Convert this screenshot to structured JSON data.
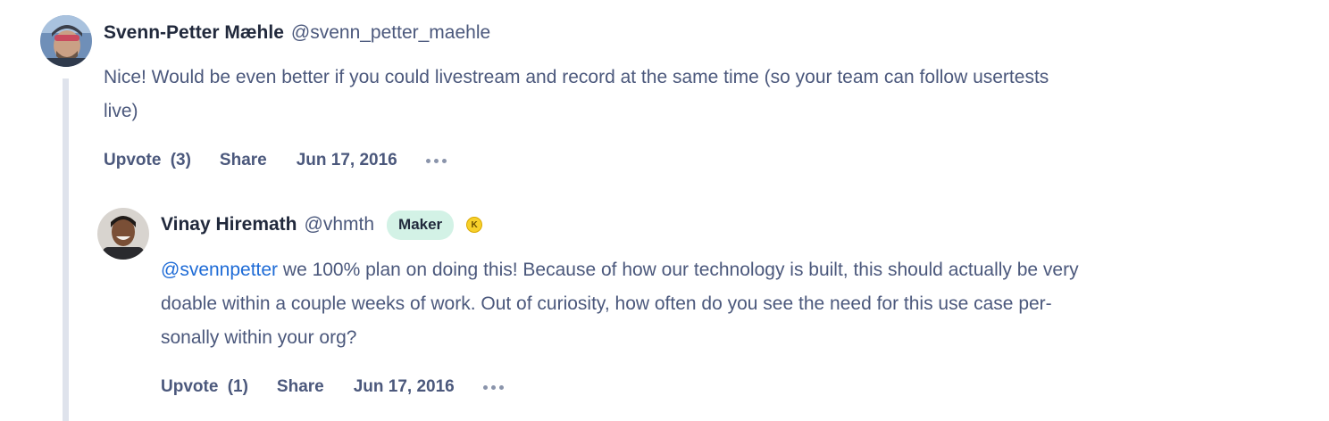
{
  "comments": [
    {
      "author": "Svenn-Petter Mæhle",
      "handle": "@svenn_petter_maehle",
      "body": "Nice! Would be even better if you could livestream and record at the same time (so your team can follow usertests",
      "body_line2": "live)",
      "upvote_label": "Upvote",
      "upvote_count": "(3)",
      "share_label": "Share",
      "date": "Jun 17, 2016"
    },
    {
      "author": "Vinay Hiremath",
      "handle": "@vhmth",
      "badge": "Maker",
      "karma_letter": "K",
      "mention": "@svennpetter",
      "body_line1": " we 100% plan on doing this! Because of how our technology is built, this should actually be very",
      "body_line2": "doable within a couple weeks of work. Out of curiosity, how often do you see the need for this use case per-",
      "body_line3": "sonally within your org?",
      "upvote_label": "Upvote",
      "upvote_count": "(1)",
      "share_label": "Share",
      "date": "Jun 17, 2016"
    }
  ],
  "colors": {
    "text_primary": "#21293c",
    "text_secondary": "#4b587c",
    "mention": "#1e6bd6",
    "maker_badge_bg": "#d3f2e6",
    "thread_line": "#dfe3ec"
  },
  "icons": {
    "more": "more-horizontal-icon",
    "karma": "karma-badge-icon"
  }
}
